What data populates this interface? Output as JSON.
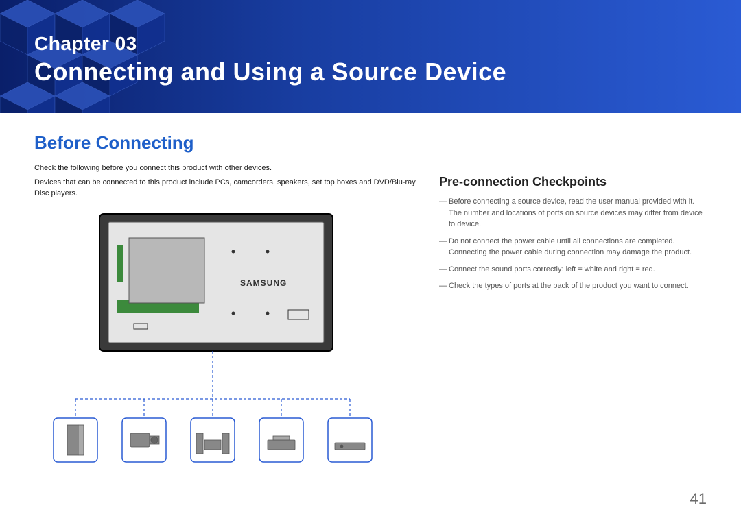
{
  "banner": {
    "chapter_label": "Chapter  03",
    "chapter_title": "Connecting and Using a Source Device"
  },
  "main": {
    "heading": "Before Connecting",
    "intro1": "Check the following before you connect this product with other devices.",
    "intro2": "Devices that can be connected to this product include PCs, camcorders, speakers, set top boxes and DVD/Blu-ray Disc players."
  },
  "checkpoints": {
    "heading": "Pre-connection Checkpoints",
    "items": [
      "Before connecting a source device, read the user manual provided with it. The number and locations of ports on source devices may differ from device to device.",
      "Do not connect the power cable until all connections are completed. Connecting the power cable during connection may damage the product.",
      "Connect the sound ports correctly: left = white and right = red.",
      "Check the types of ports at the back of the product you want to connect."
    ]
  },
  "diagram": {
    "monitor_brand": "SAMSUNG"
  },
  "page_number": "41"
}
